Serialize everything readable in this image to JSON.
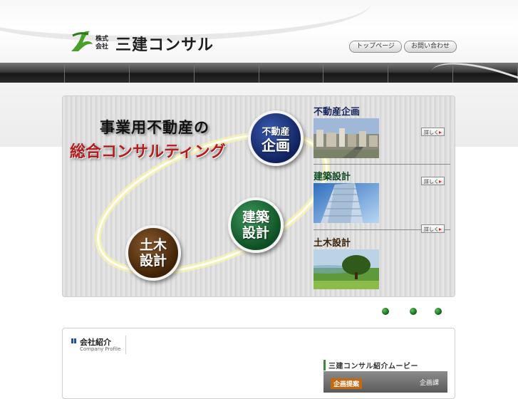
{
  "header": {
    "logo_small_1": "株式",
    "logo_small_2": "会社",
    "company_name": "三建コンサル",
    "top_page_label": "トップページ",
    "contact_label": "お問い合わせ"
  },
  "hero": {
    "title_line1": "事業用不動産の",
    "title_line2": "総合コンサルティング",
    "circles": {
      "plan_line1": "不動産",
      "plan_line2": "企画",
      "arch_line1": "建築",
      "arch_line2": "設計",
      "civil_line1": "土木",
      "civil_line2": "設計"
    },
    "categories": [
      {
        "title": "不動産企画",
        "more": "詳しく"
      },
      {
        "title": "建築設計",
        "more": "詳しく"
      },
      {
        "title": "土木設計",
        "more": "詳しく"
      }
    ]
  },
  "company": {
    "title": "会社紹介",
    "subtitle": "Company Profile",
    "movie_title": "三建コンサル紹介ムービー",
    "movie_tag": "企画提案",
    "movie_right": "企画課"
  },
  "colors": {
    "plan": "#13235a",
    "arch": "#0e4a22",
    "civil": "#3b2408",
    "accent_red": "#b41d1d",
    "dots": "#1e7a1e"
  }
}
